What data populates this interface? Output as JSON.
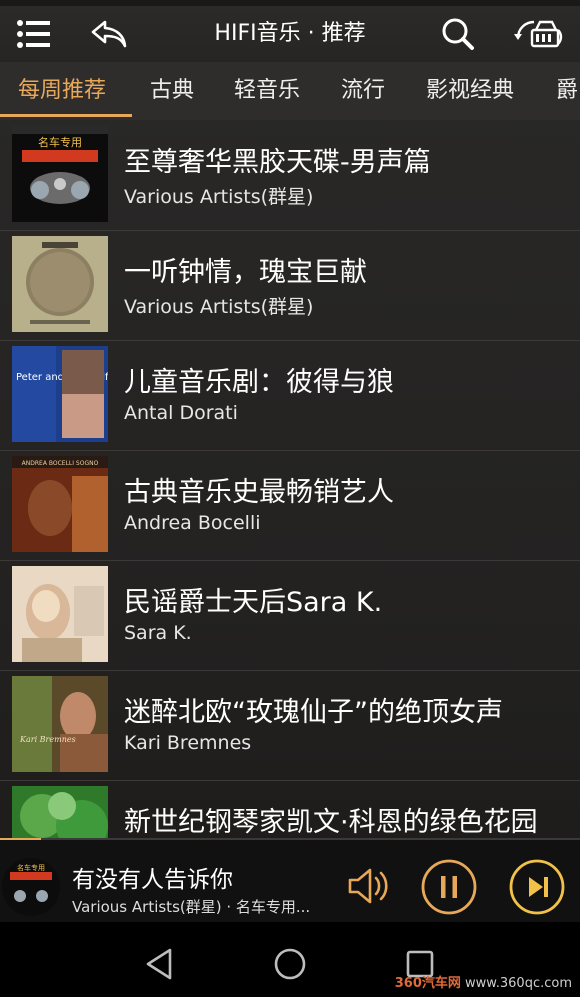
{
  "header": {
    "title": "HIFI音乐 · 推荐",
    "menu_icon": "menu-icon",
    "back_icon": "back-icon",
    "search_icon": "search-icon",
    "car_icon": "car-sync-icon"
  },
  "tabs": [
    {
      "label": "每周推荐",
      "active": true
    },
    {
      "label": "古典",
      "active": false
    },
    {
      "label": "轻音乐",
      "active": false
    },
    {
      "label": "流行",
      "active": false
    },
    {
      "label": "影视经典",
      "active": false
    },
    {
      "label": "爵",
      "active": false
    }
  ],
  "albums": [
    {
      "title": "至尊奢华黑胶天碟-男声篇",
      "artist": "Various Artists(群星)",
      "cover_text": "名车专用"
    },
    {
      "title": "一听钟情，瑰宝巨献",
      "artist": "Various Artists(群星)",
      "cover_text": ""
    },
    {
      "title": "儿童音乐剧：彼得与狼",
      "artist": "Antal Dorati",
      "cover_text": "Peter and the Wolf"
    },
    {
      "title": "古典音乐史最畅销艺人",
      "artist": "Andrea Bocelli",
      "cover_text": "ANDREA BOCELLI SOGNO"
    },
    {
      "title": "民谣爵士天后Sara K.",
      "artist": "Sara K.",
      "cover_text": ""
    },
    {
      "title": "迷醉北欧“玫瑰仙子”的绝顶女声",
      "artist": "Kari Bremnes",
      "cover_text": "Kari Bremnes"
    },
    {
      "title": "新世纪钢琴家凯文·科恩的绿色花园",
      "artist": "",
      "cover_text": ""
    }
  ],
  "player": {
    "title": "有没有人告诉你",
    "subtitle": "Various Artists(群星) · 名车专用...",
    "cover_text": "名车专用",
    "progress": 0.07,
    "volume_icon": "volume-icon",
    "pause_icon": "pause-icon",
    "next_icon": "next-icon"
  },
  "navbar": {
    "back_icon": "nav-back-icon",
    "home_icon": "nav-home-icon",
    "recent_icon": "nav-recent-icon"
  },
  "watermark": {
    "brand": "360汽车网",
    "url": "www.360qc.com"
  },
  "colors": {
    "accent": "#e8a85a",
    "background": "#252423"
  }
}
